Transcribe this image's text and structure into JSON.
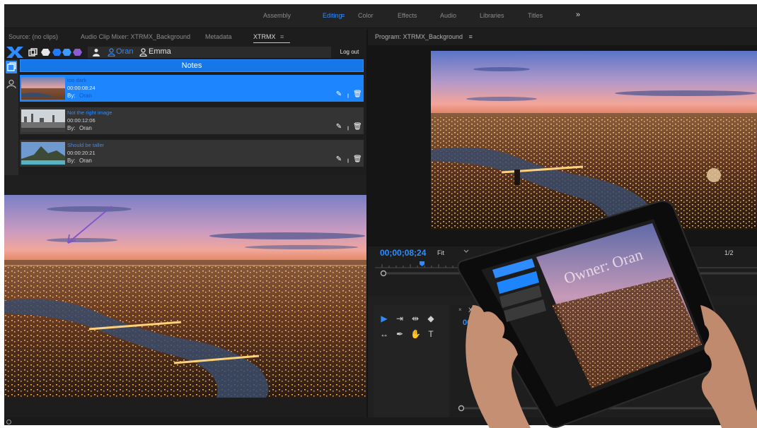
{
  "workspace": {
    "tabs": [
      "Assembly",
      "Editing",
      "Color",
      "Effects",
      "Audio",
      "Libraries",
      "Titles"
    ],
    "active": "Editing",
    "menu_glyph": "≡",
    "more_glyph": "»"
  },
  "source_panel": {
    "tabs": [
      "Source: (no clips)",
      "Audio Clip Mixer: XTRMX_Background",
      "Metadata",
      "XTRMX"
    ],
    "active_tab": "XTRMX",
    "menu_glyph": "≡"
  },
  "xtrmx": {
    "users": [
      {
        "name": "Oran",
        "color": "#2f8cff"
      },
      {
        "name": "Emma",
        "color": "#e6e6e6"
      }
    ],
    "logout_label": "Log out",
    "notes_header": "Notes",
    "notes": [
      {
        "title": "too dark",
        "time": "00:00:08:24",
        "by_label": "By:",
        "author": "Oran",
        "selected": true
      },
      {
        "title": "Not the right image",
        "time": "00:00:12:06",
        "by_label": "By:",
        "author": "Oran",
        "selected": false
      },
      {
        "title": "Should be taller",
        "time": "00:00:20:21",
        "by_label": "By:",
        "author": "Oran",
        "selected": false
      }
    ],
    "icons": [
      "pencil-icon",
      "pin-icon",
      "trash-icon"
    ]
  },
  "program_panel": {
    "title": "Program: XTRMX_Background",
    "menu_glyph": "≡",
    "timecode": "00;00;08;24",
    "fit_label": "Fit",
    "resolution": "1/2"
  },
  "timeline": {
    "close_glyph": "×",
    "tab_label": "XT",
    "timecode": "00"
  },
  "tablet": {
    "owner_text": "Owner: Oran"
  },
  "colors": {
    "accent": "#2f8cff",
    "panel": "#1d1d1d",
    "note_selected": "#1d86ff"
  }
}
